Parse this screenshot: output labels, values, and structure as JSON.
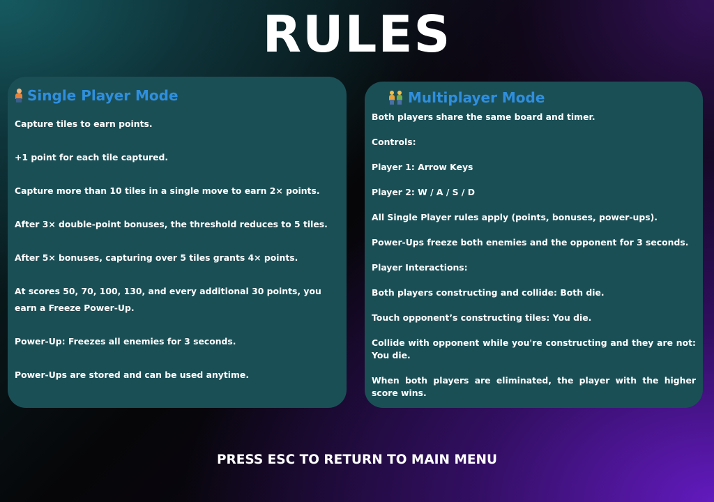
{
  "page": {
    "title": "RULES",
    "footer": "PRESS ESC TO RETURN TO MAIN MENU"
  },
  "colors": {
    "panel_background": "#1b4f56",
    "heading_blue": "#2f8fde",
    "text": "#ffffff"
  },
  "single_player": {
    "icon": "person-icon",
    "heading": "Single Player Mode",
    "rules": [
      "Capture tiles to earn points.",
      "+1 point for each tile captured.",
      "Capture more than 10 tiles in a single move to earn 2× points.",
      "After 3× double-point bonuses, the threshold reduces to 5 tiles.",
      "After 5× bonuses, capturing over 5 tiles grants 4× points.",
      "At scores 50, 70, 100, 130, and every additional 30 points, you earn a Freeze Power-Up.",
      "Power-Up: Freezes all enemies for 3 seconds.",
      "Power-Ups are stored and can be used anytime."
    ]
  },
  "multiplayer": {
    "icon": "two-people-icon",
    "heading": "Multiplayer Mode",
    "rules": [
      "Both players share the same board and timer.",
      "Controls:",
      "Player 1: Arrow Keys",
      "Player 2: W / A / S / D",
      "All Single Player rules apply (points, bonuses, power-ups).",
      "Power-Ups freeze both enemies and the opponent for 3 seconds.",
      "Player Interactions:",
      "Both players constructing and collide: Both die.",
      "Touch opponent’s constructing tiles: You die.",
      "Collide with opponent while you're constructing and they are not: You die.",
      "When both players are eliminated, the player with the higher score wins."
    ]
  }
}
